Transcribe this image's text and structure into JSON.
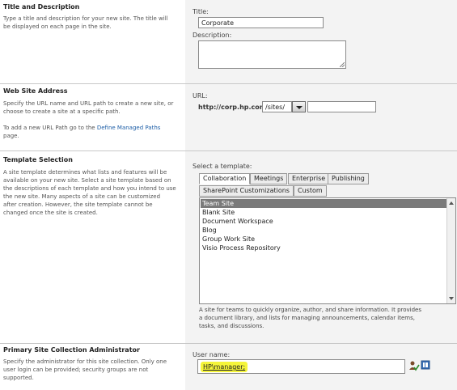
{
  "title_section": {
    "heading": "Title and Description",
    "description": [
      "Type a title and description for your new site. The title will",
      "be displayed on each page in the site."
    ],
    "title_label": "Title:",
    "title_value": "Corporate",
    "description_label": "Description:",
    "description_value": ""
  },
  "address_section": {
    "heading": "Web Site Address",
    "description": [
      "Specify the URL name and URL path to create a new site, or",
      "choose to create a site at a specific path."
    ],
    "note_prefix": "To add a new URL Path go to the ",
    "note_link": "Define Managed Paths",
    "note_suffix": "page.",
    "url_label": "URL:",
    "url_prefix": "http://corp.hp.com",
    "path_value": "/sites/",
    "name_value": ""
  },
  "template_section": {
    "heading": "Template Selection",
    "description": [
      "A site template determines what lists and features will be",
      "available on your new site. Select a site template based on",
      "the descriptions of each template and how you intend to use",
      "the new site. Many aspects of a site can be customized",
      "after creation. However, the site template cannot be",
      "changed once the site is created."
    ],
    "select_label": "Select a template:",
    "tabs_row1": [
      "Collaboration",
      "Meetings",
      "Enterprise",
      "Publishing"
    ],
    "tabs_row2": [
      "SharePoint Customizations",
      "Custom"
    ],
    "active_tab": "Collaboration",
    "templates": [
      "Team Site",
      "Blank Site",
      "Document Workspace",
      "Blog",
      "Group Work Site",
      "Visio Process Repository"
    ],
    "selected_template": "Team Site",
    "template_desc": [
      "A site for teams to quickly organize, author, and share information. It provides",
      "a document library, and lists for managing announcements, calendar items,",
      "tasks, and discussions."
    ]
  },
  "admin_section": {
    "heading": "Primary Site Collection Administrator",
    "description": [
      "Specify the administrator for this site collection. Only one",
      "user login can be provided; security groups are not",
      "supported."
    ],
    "user_label": "User name:",
    "user_value": "HP\\manager;",
    "highlight_color": "#f5f53a"
  },
  "icons": [
    "check-names-icon",
    "browse-address-book-icon"
  ]
}
